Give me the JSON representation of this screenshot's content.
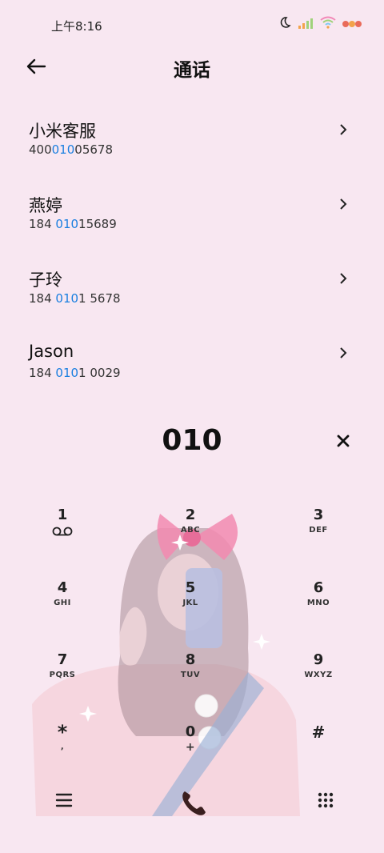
{
  "status_bar": {
    "time": "上午8:16",
    "icons": [
      "moon-icon",
      "signal-icon",
      "wifi-icon",
      "battery-icon"
    ]
  },
  "header": {
    "title": "通话",
    "back_icon": "arrow-left-icon"
  },
  "results": [
    {
      "name": "小米客服",
      "number_pre": "400",
      "number_match": "010",
      "number_post": "05678"
    },
    {
      "name": "燕婷",
      "number_pre": "184 ",
      "number_match": "010",
      "number_post": "15689"
    },
    {
      "name": "子玲",
      "number_pre": "184 ",
      "number_match": "010",
      "number_post": "1 5678"
    },
    {
      "name": "Jason",
      "number_pre": "184 ",
      "number_match": "010",
      "number_post": "1 0029"
    }
  ],
  "dialed_number": "010",
  "keypad": {
    "keys": [
      {
        "digit": "1",
        "letters": ""
      },
      {
        "digit": "2",
        "letters": "ABC"
      },
      {
        "digit": "3",
        "letters": "DEF"
      },
      {
        "digit": "4",
        "letters": "GHI"
      },
      {
        "digit": "5",
        "letters": "JKL"
      },
      {
        "digit": "6",
        "letters": "MNO"
      },
      {
        "digit": "7",
        "letters": "PQRS"
      },
      {
        "digit": "8",
        "letters": "TUV"
      },
      {
        "digit": "9",
        "letters": "WXYZ"
      },
      {
        "digit": "*",
        "letters": ","
      },
      {
        "digit": "0",
        "letters": "+"
      },
      {
        "digit": "#",
        "letters": ""
      }
    ]
  },
  "colors": {
    "background": "#f8e7f1",
    "match_highlight": "#1a7fe0",
    "call_button": "#3a1f1f"
  }
}
